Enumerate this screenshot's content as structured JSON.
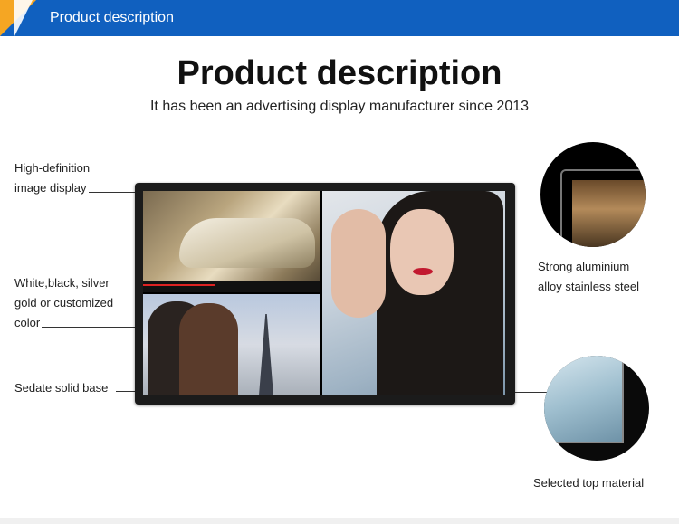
{
  "banner": {
    "title": "Product description"
  },
  "heading": {
    "title": "Product description",
    "subtitle": "It has been an advertising display manufacturer since 2013"
  },
  "callouts": {
    "left": [
      {
        "line1": "High-definition",
        "line2": "image display"
      },
      {
        "line1": "White,black, silver",
        "line2": "gold or customized",
        "line3": "color"
      },
      {
        "line1": "Sedate solid base"
      }
    ],
    "right": [
      {
        "line1": "Strong aluminium",
        "line2": "alloy stainless steel"
      },
      {
        "line1": "Selected top material"
      }
    ]
  },
  "colors": {
    "banner": "#1060bf",
    "accent": "#f5a623"
  }
}
